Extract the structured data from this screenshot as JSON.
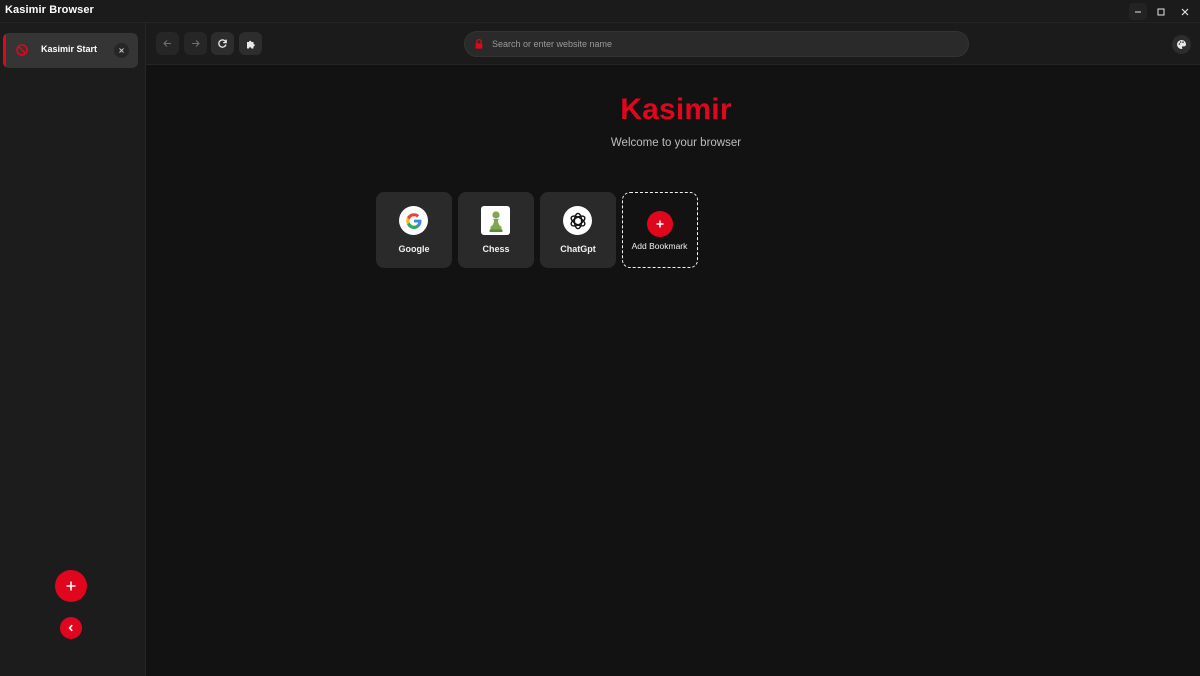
{
  "window": {
    "title": "Kasimir Browser"
  },
  "sidebar": {
    "tabs": [
      {
        "label": "Kasimir Start",
        "icon": "kasimir-logo-icon",
        "active": true
      }
    ],
    "new_tab_icon": "plus-icon",
    "collapse_icon": "chevron-left-icon"
  },
  "toolbar": {
    "back_icon": "arrow-left-icon",
    "forward_icon": "arrow-right-icon",
    "reload_icon": "reload-icon",
    "extensions_icon": "puzzle-icon",
    "theme_icon": "palette-icon"
  },
  "search": {
    "placeholder": "Search or enter website name",
    "value": ""
  },
  "start_page": {
    "brand": "Kasimir",
    "welcome": "Welcome to your browser",
    "bookmarks": [
      {
        "label": "Google",
        "icon": "google-icon"
      },
      {
        "label": "Chess",
        "icon": "chess-pawn-icon"
      },
      {
        "label": "ChatGpt",
        "icon": "chatgpt-icon"
      }
    ],
    "add_bookmark_label": "Add Bookmark"
  },
  "colors": {
    "accent": "#e0061e",
    "background": "#121212",
    "panel": "#1c1c1c",
    "tile": "#2a2a2a"
  }
}
